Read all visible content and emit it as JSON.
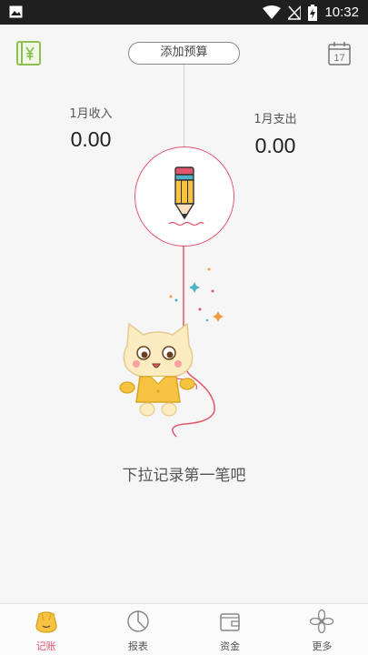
{
  "status_bar": {
    "time": "10:32",
    "icons": [
      "image-icon",
      "wifi-icon",
      "no-signal-icon",
      "battery-charging-icon"
    ]
  },
  "header": {
    "wallet_icon": "wallet-yen-icon",
    "budget_button_label": "添加预算",
    "calendar_icon": "calendar-icon",
    "calendar_day": "17"
  },
  "summary": {
    "income_label": "1月收入",
    "income_value": "0.00",
    "expense_label": "1月支出",
    "expense_value": "0.00"
  },
  "record_button": {
    "icon": "pencil-icon"
  },
  "empty_hint": "下拉记录第一笔吧",
  "tabs": [
    {
      "label": "记账",
      "icon": "bag-icon",
      "active": true
    },
    {
      "label": "报表",
      "icon": "pie-chart-icon",
      "active": false
    },
    {
      "label": "资金",
      "icon": "wallet-icon",
      "active": false
    },
    {
      "label": "更多",
      "icon": "flower-icon",
      "active": false
    }
  ],
  "colors": {
    "accent": "#e2566c",
    "brand_green": "#8cc152",
    "status_bar": "#1f1f1f",
    "background": "#f6f6f6"
  }
}
